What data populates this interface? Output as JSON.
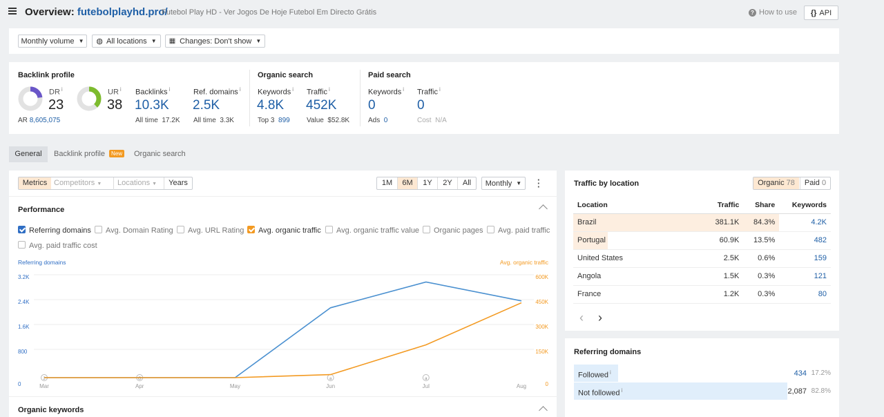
{
  "header": {
    "title_prefix": "Overview:",
    "domain": "futebolplayhd.pro/",
    "subtitle": "Futebol Play HD - Ver Jogos De Hoje Futebol Em Directo Grátis",
    "how_to_use": "How to use",
    "api": "API"
  },
  "filters": {
    "volume": "Monthly volume",
    "locations": "All locations",
    "changes": "Changes: Don't show"
  },
  "metrics": {
    "backlink_profile": "Backlink profile",
    "dr_label": "DR",
    "dr_value": "23",
    "ar_label": "AR",
    "ar_value": "8,605,075",
    "ur_label": "UR",
    "ur_value": "38",
    "backlinks_label": "Backlinks",
    "backlinks_value": "10.3K",
    "backlinks_alltime_label": "All time",
    "backlinks_alltime": "17.2K",
    "refdomains_label": "Ref. domains",
    "refdomains_value": "2.5K",
    "refdomains_alltime_label": "All time",
    "refdomains_alltime": "3.3K",
    "organic_search": "Organic search",
    "org_keywords_label": "Keywords",
    "org_keywords_value": "4.8K",
    "org_top3_label": "Top 3",
    "org_top3_value": "899",
    "org_traffic_label": "Traffic",
    "org_traffic_value": "452K",
    "org_value_label": "Value",
    "org_value_value": "$52.8K",
    "paid_search": "Paid search",
    "paid_keywords_label": "Keywords",
    "paid_keywords_value": "0",
    "paid_ads_label": "Ads",
    "paid_ads_value": "0",
    "paid_traffic_label": "Traffic",
    "paid_traffic_value": "0",
    "paid_cost_label": "Cost",
    "paid_cost_value": "N/A",
    "info_mark": "i",
    "dr_ring_fraction": 0.23,
    "ur_ring_fraction": 0.38,
    "dr_ring_color": "#6a56c8",
    "ur_ring_color": "#7dbb2e"
  },
  "tabs": {
    "general": "General",
    "backlink_profile": "Backlink profile",
    "new_badge": "New",
    "organic_search": "Organic search"
  },
  "chart_controls": {
    "metrics": "Metrics",
    "competitors": "Competitors",
    "locations": "Locations",
    "years": "Years",
    "ranges": [
      "1M",
      "6M",
      "1Y",
      "2Y",
      "All"
    ],
    "active_range": "6M",
    "granularity": "Monthly"
  },
  "performance": {
    "title": "Performance",
    "checkboxes": [
      {
        "label": "Referring domains",
        "checked": true
      },
      {
        "label": "Avg. Domain Rating",
        "checked": false
      },
      {
        "label": "Avg. URL Rating",
        "checked": false
      },
      {
        "label": "Avg. organic traffic",
        "checked": true
      },
      {
        "label": "Avg. organic traffic value",
        "checked": false
      },
      {
        "label": "Organic pages",
        "checked": false
      },
      {
        "label": "Avg. paid traffic",
        "checked": false
      },
      {
        "label": "Avg. paid traffic cost",
        "checked": false
      }
    ]
  },
  "chart_data": {
    "type": "line",
    "x": [
      "Mar",
      "Apr",
      "May",
      "Jun",
      "Jul",
      "Aug"
    ],
    "markers": [
      "2",
      "G",
      "",
      "a",
      "a",
      ""
    ],
    "left_axis_label": "Referring domains",
    "right_axis_label": "Avg. organic traffic",
    "left_ticks": [
      "0",
      "800",
      "1.6K",
      "2.4K",
      "3.2K"
    ],
    "right_ticks": [
      "0",
      "150K",
      "300K",
      "450K",
      "600K"
    ],
    "left_ylim": [
      0,
      3200
    ],
    "right_ylim": [
      0,
      600000
    ],
    "series": [
      {
        "name": "Referring domains",
        "axis": "left",
        "color": "#4a90d0",
        "values": [
          0,
          0,
          0,
          2330,
          3190,
          2560
        ]
      },
      {
        "name": "Avg. organic traffic",
        "axis": "right",
        "color": "#f39a22",
        "values": [
          0,
          0,
          0,
          19000,
          205000,
          468000
        ]
      }
    ],
    "grid": true
  },
  "organic_keywords": {
    "title": "Organic keywords"
  },
  "traffic_by_location": {
    "title": "Traffic by location",
    "organic_label": "Organic",
    "organic_count": "78",
    "paid_label": "Paid",
    "paid_count": "0",
    "columns": [
      "Location",
      "Traffic",
      "Share",
      "Keywords"
    ],
    "rows": [
      {
        "location": "Brazil",
        "traffic": "381.1K",
        "share": "84.3%",
        "keywords": "4.2K",
        "share_fraction": 0.843
      },
      {
        "location": "Portugal",
        "traffic": "60.9K",
        "share": "13.5%",
        "keywords": "482",
        "share_fraction": 0.135
      },
      {
        "location": "United States",
        "traffic": "2.5K",
        "share": "0.6%",
        "keywords": "159",
        "share_fraction": 0.006
      },
      {
        "location": "Angola",
        "traffic": "1.5K",
        "share": "0.3%",
        "keywords": "121",
        "share_fraction": 0.003
      },
      {
        "location": "France",
        "traffic": "1.2K",
        "share": "0.3%",
        "keywords": "80",
        "share_fraction": 0.003
      }
    ],
    "prev": "‹",
    "next": "›"
  },
  "referring_domains": {
    "title": "Referring domains",
    "rows": [
      {
        "label": "Followed",
        "count": "434",
        "pct": "17.2%",
        "fraction": 0.172
      },
      {
        "label": "Not followed",
        "count": "2,087",
        "pct": "82.8%",
        "fraction": 0.828
      }
    ]
  }
}
